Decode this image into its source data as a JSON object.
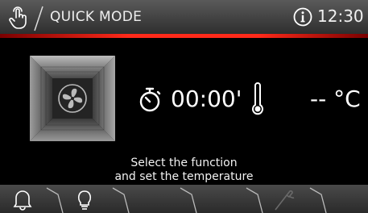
{
  "header": {
    "mode_title": "QUICK MODE",
    "clock": "12:30"
  },
  "main": {
    "timer": "00:00'",
    "temperature": "-- °C",
    "message_line1": "Select the function",
    "message_line2": "and set the temperature"
  },
  "colors": {
    "accent_red": "#ff2a1a",
    "background": "#000000"
  },
  "icons": {
    "touch": "touch-hand-icon",
    "info": "info-icon",
    "fan": "fan-icon",
    "timer": "stopwatch-icon",
    "thermometer": "thermometer-icon",
    "bell": "bell-icon",
    "bulb": "bulb-icon",
    "probe": "meat-probe-icon"
  }
}
